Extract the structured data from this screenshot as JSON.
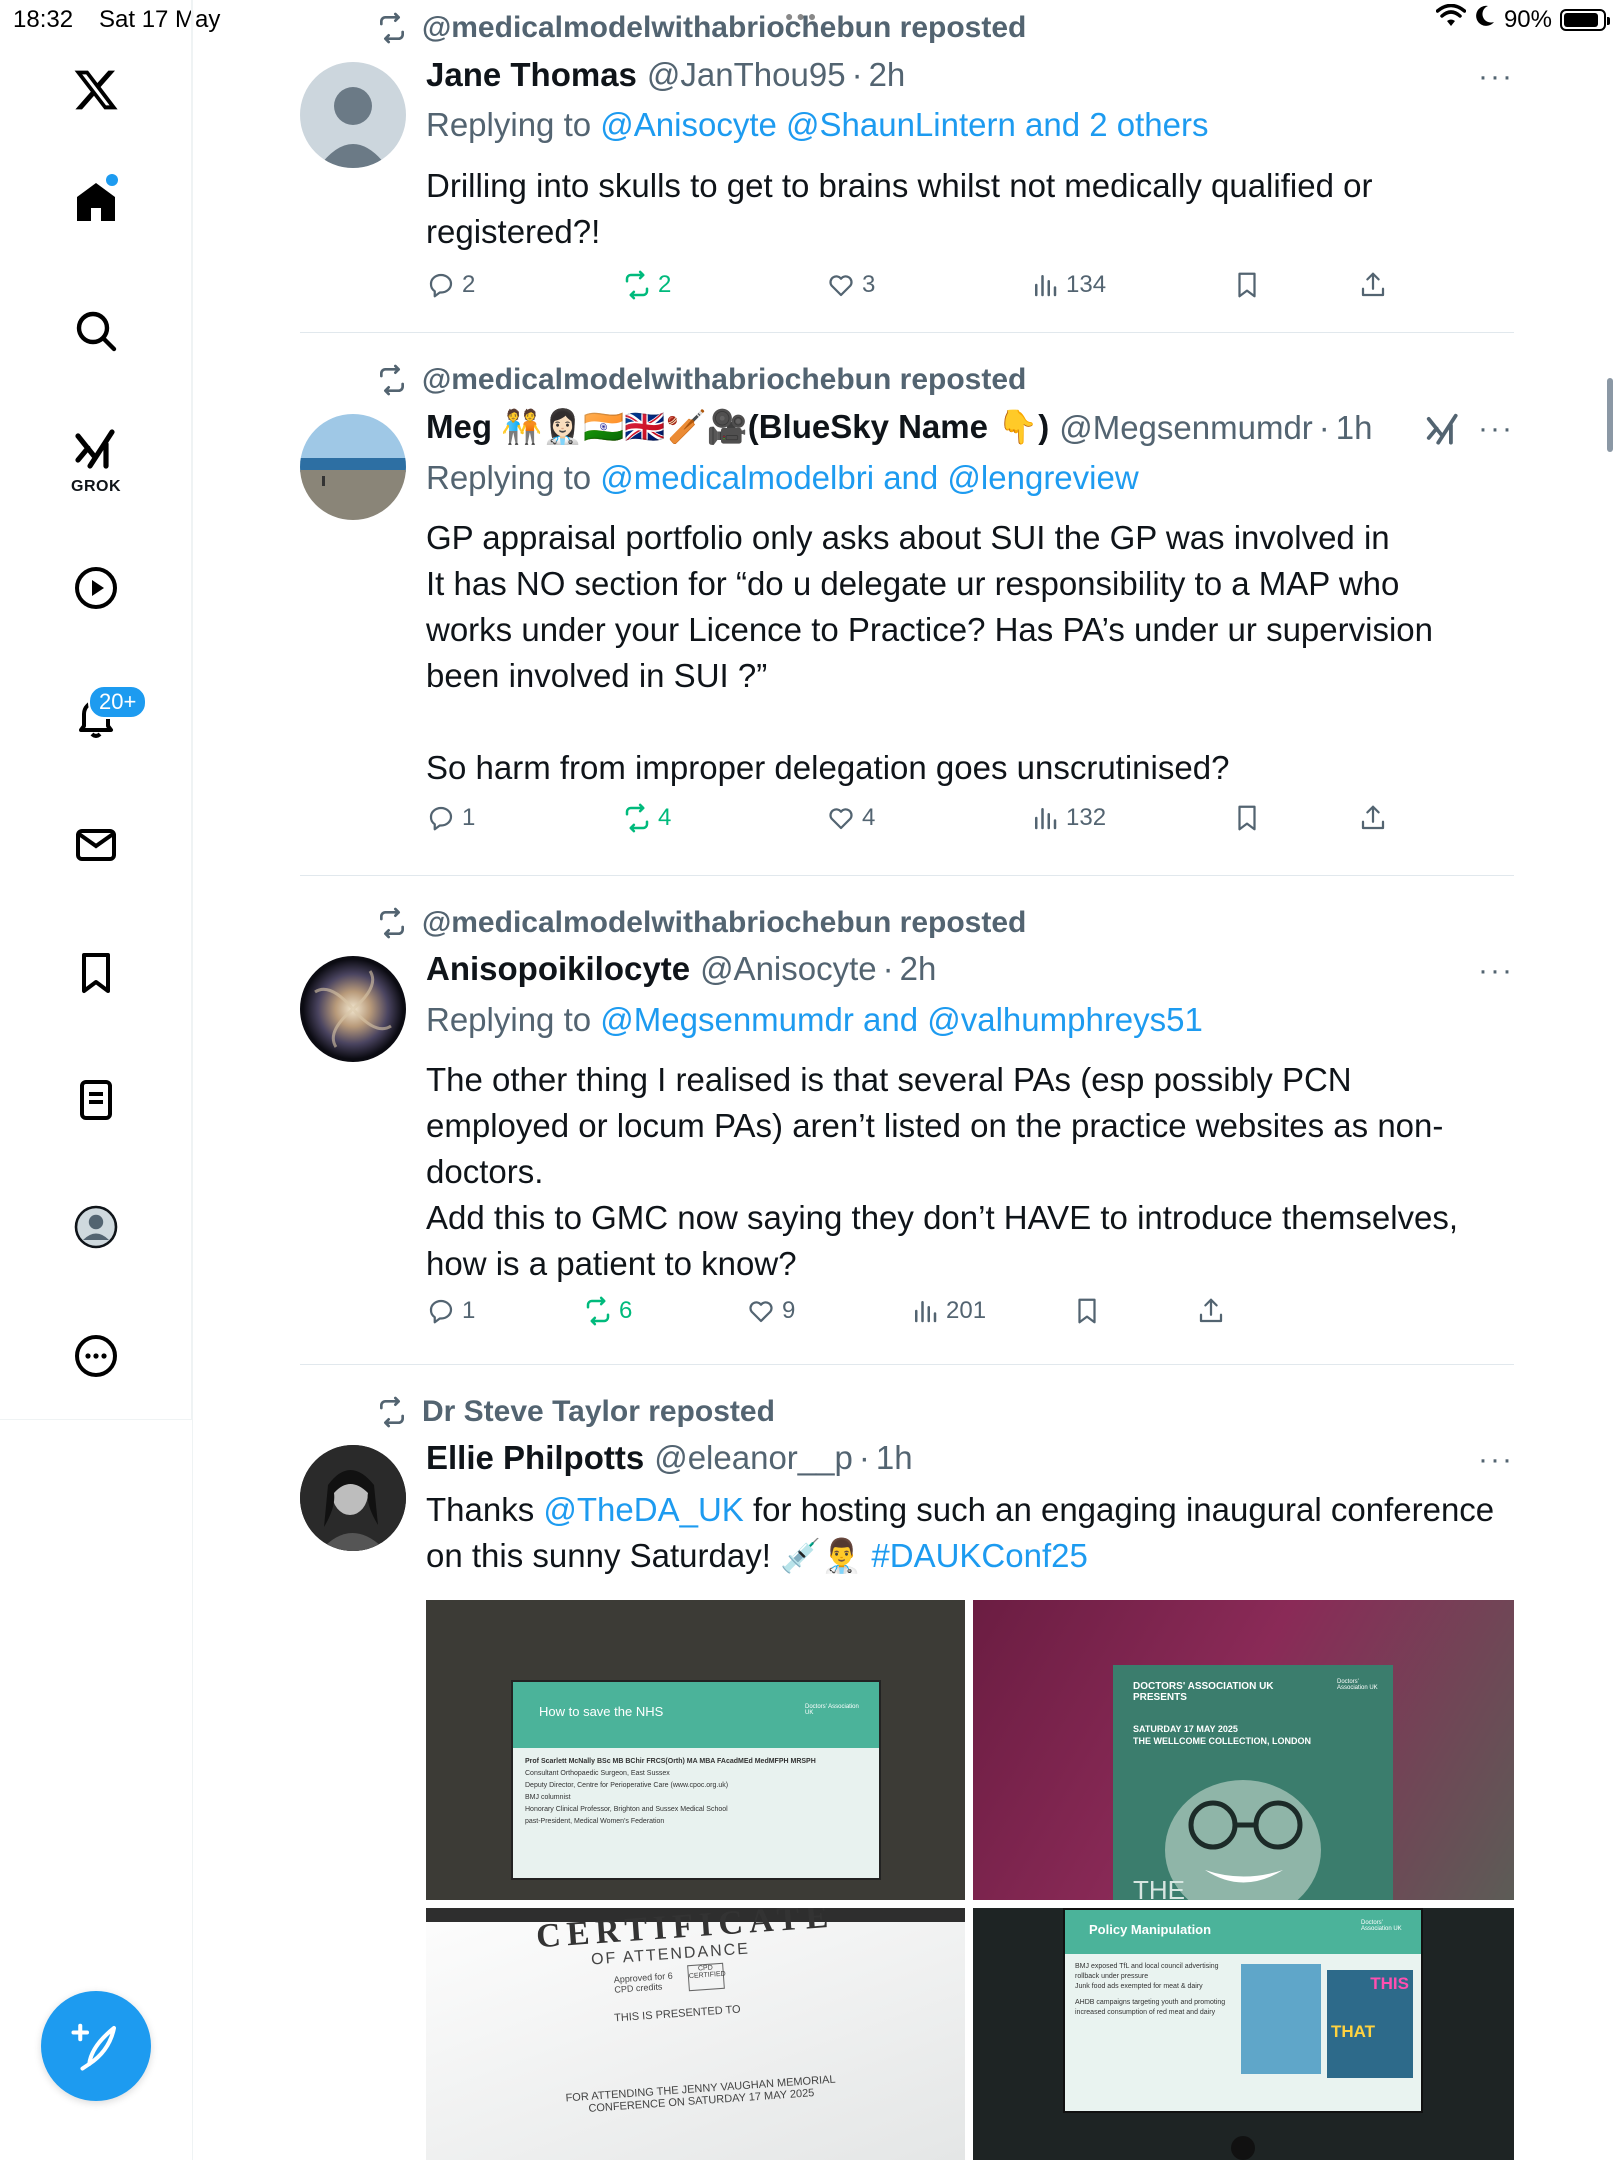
{
  "status_bar": {
    "time": "18:32",
    "date": "Sat 17 May",
    "battery": "90%",
    "battery_level": 0.9
  },
  "nav": {
    "items": [
      "x-logo",
      "home",
      "search",
      "grok",
      "videos",
      "notifications",
      "messages",
      "bookmarks",
      "lists",
      "profile",
      "more"
    ],
    "grok_label": "GROK",
    "notifications_badge": "20+"
  },
  "colors": {
    "accent": "#1d9bf0",
    "repost_green": "#00ba7c",
    "muted": "#536471",
    "text": "#0f1419"
  },
  "posts": [
    {
      "reposted_by": "@medicalmodelwithabriochebun reposted",
      "name": "Jane Thomas",
      "handle": "@JanThou95",
      "time": "2h",
      "replying_prefix": "Replying to ",
      "replying_links": "@Anisocyte @ShaunLintern and 2 others",
      "text_lines": [
        "Drilling into skulls to get to brains whilst not medically qualified or",
        "registered?!"
      ],
      "replies": "2",
      "reposts": "2",
      "likes": "3",
      "views": "134"
    },
    {
      "reposted_by": "@medicalmodelwithabriochebun reposted",
      "name": "Meg 🧑‍🤝‍🧑👩🏻‍⚕️🇮🇳🇬🇧🏏🎥(BlueSky Name 👇)",
      "handle": "@Megsenmumdr",
      "time": "1h",
      "replying_prefix": "Replying to ",
      "replying_links": "@medicalmodelbri and @lengreview",
      "text_lines": [
        "GP appraisal portfolio only asks about SUI the GP was involved in",
        "It has NO section for “do u delegate ur responsibility to a MAP who",
        "works under your Licence to Practice? Has PA’s under ur supervision",
        "been involved in SUI ?”",
        "",
        "So harm from improper delegation goes unscrutinised?"
      ],
      "replies": "1",
      "reposts": "4",
      "likes": "4",
      "views": "132"
    },
    {
      "reposted_by": "@medicalmodelwithabriochebun reposted",
      "name": "Anisopoikilocyte",
      "handle": "@Anisocyte",
      "time": "2h",
      "replying_prefix": "Replying to ",
      "replying_links": "@Megsenmumdr and @valhumphreys51",
      "text_lines": [
        "The other thing I realised is that several PAs (esp possibly PCN",
        "employed or locum PAs) aren’t listed on the practice websites as non-",
        "doctors.",
        "Add this to GMC now saying they don’t HAVE to introduce themselves,",
        "how is a patient to know?"
      ],
      "replies": "1",
      "reposts": "6",
      "likes": "9",
      "views": "201"
    },
    {
      "reposted_by": "Dr Steve Taylor reposted",
      "name": "Ellie Philpotts",
      "handle": "@eleanor__p",
      "time": "1h",
      "text_a": "Thanks ",
      "link_a": "@TheDA_UK",
      "text_b": " for hosting such an engaging inaugural conference",
      "text_c": "on this sunny Saturday! 💉👨‍⚕️ ",
      "link_b": "#DAUKConf25",
      "media": [
        {
          "title": "How to save the NHS",
          "logo": "Doctors' Association UK",
          "lines": [
            "Prof Scarlett McNally BSc MB BChir FRCS(Orth) MA MBA FAcadMEd MedMFPH MRSPH",
            "Consultant Orthopaedic Surgeon, East Sussex",
            "Deputy Director, Centre for Perioperative Care (www.cpoc.org.uk)",
            "BMJ columnist",
            "Honorary Clinical Professor, Brighton and Sussex Medical School",
            "past-President, Medical Women's Federation"
          ]
        },
        {
          "header": "DOCTORS' ASSOCIATION UK PRESENTS",
          "logo": "Doctors' Association UK",
          "lines": [
            "SATURDAY 17 MAY 2025",
            "THE WELLCOME COLLECTION, LONDON"
          ],
          "footer": "THE"
        },
        {
          "title": "CERTIFICATE",
          "subtitle": "OF ATTENDANCE",
          "cpd": "Approved for 6 CPD credits",
          "cpd_badge": "CPD CERTIFIED",
          "presented": "THIS IS PRESENTED TO",
          "footer": "FOR ATTENDING THE JENNY VAUGHAN MEMORIAL CONFERENCE ON SATURDAY 17 MAY 2025"
        },
        {
          "title": "Policy Manipulation",
          "logo": "Doctors' Association UK",
          "bullets": [
            "BMJ exposed TfL and local council advertising rollback under pressure",
            "Junk food ads exempted for meat & dairy",
            "AHDB campaigns targeting youth and promoting increased consumption of red meat and dairy"
          ],
          "poster_a": "THIS",
          "poster_b": "THAT"
        }
      ]
    }
  ]
}
